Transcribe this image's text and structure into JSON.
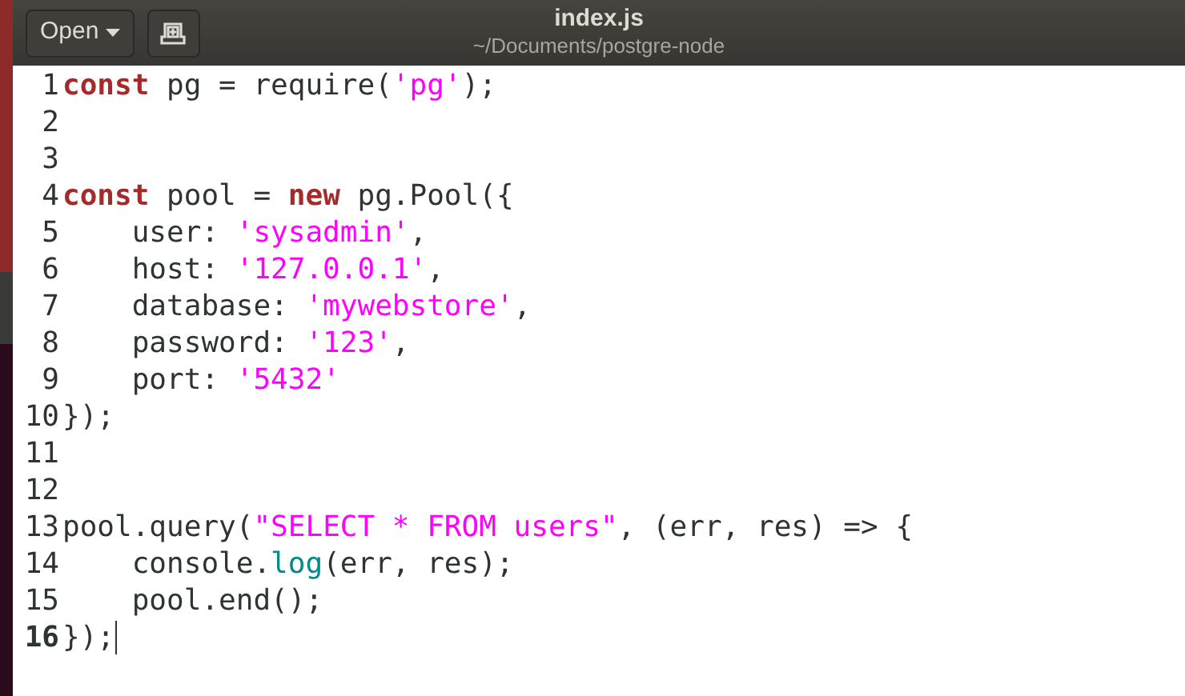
{
  "header": {
    "open_button": {
      "label": "Open"
    },
    "title": "index.js",
    "subtitle": "~/Documents/postgre-node"
  },
  "editor": {
    "lines": [
      {
        "number": "1",
        "current": false,
        "tokens": [
          {
            "kind": "keyword",
            "text": "const"
          },
          {
            "kind": "plain",
            "text": " pg = require("
          },
          {
            "kind": "string",
            "text": "'pg'"
          },
          {
            "kind": "plain",
            "text": ");"
          }
        ]
      },
      {
        "number": "2",
        "current": false
      },
      {
        "number": "3",
        "current": false
      },
      {
        "number": "4",
        "current": false,
        "tokens": [
          {
            "kind": "keyword",
            "text": "const"
          },
          {
            "kind": "plain",
            "text": " pool = "
          },
          {
            "kind": "keyword",
            "text": "new"
          },
          {
            "kind": "plain",
            "text": " pg.Pool({"
          }
        ]
      },
      {
        "number": "5",
        "current": false,
        "tokens": [
          {
            "kind": "plain",
            "text": "    user: "
          },
          {
            "kind": "string",
            "text": "'sysadmin'"
          },
          {
            "kind": "plain",
            "text": ","
          }
        ]
      },
      {
        "number": "6",
        "current": false,
        "tokens": [
          {
            "kind": "plain",
            "text": "    host: "
          },
          {
            "kind": "string",
            "text": "'127.0.0.1'"
          },
          {
            "kind": "plain",
            "text": ","
          }
        ]
      },
      {
        "number": "7",
        "current": false,
        "tokens": [
          {
            "kind": "plain",
            "text": "    database: "
          },
          {
            "kind": "string",
            "text": "'mywebstore'"
          },
          {
            "kind": "plain",
            "text": ","
          }
        ]
      },
      {
        "number": "8",
        "current": false,
        "tokens": [
          {
            "kind": "plain",
            "text": "    password: "
          },
          {
            "kind": "string",
            "text": "'123'"
          },
          {
            "kind": "plain",
            "text": ","
          }
        ]
      },
      {
        "number": "9",
        "current": false,
        "tokens": [
          {
            "kind": "plain",
            "text": "    port: "
          },
          {
            "kind": "string",
            "text": "'5432'"
          }
        ]
      },
      {
        "number": "10",
        "current": false,
        "tokens": [
          {
            "kind": "plain",
            "text": "});"
          }
        ]
      },
      {
        "number": "11",
        "current": false
      },
      {
        "number": "12",
        "current": false
      },
      {
        "number": "13",
        "current": false,
        "tokens": [
          {
            "kind": "plain",
            "text": "pool.query("
          },
          {
            "kind": "string",
            "text": "\"SELECT * FROM users\""
          },
          {
            "kind": "plain",
            "text": ", (err, res) => {"
          }
        ]
      },
      {
        "number": "14",
        "current": false,
        "tokens": [
          {
            "kind": "plain",
            "text": "    console."
          },
          {
            "kind": "builtin",
            "text": "log"
          },
          {
            "kind": "plain",
            "text": "(err, res);"
          }
        ]
      },
      {
        "number": "15",
        "current": false,
        "tokens": [
          {
            "kind": "plain",
            "text": "    pool.end();"
          }
        ]
      },
      {
        "number": "16",
        "current": true,
        "tokens": [
          {
            "kind": "plain",
            "text": "});"
          }
        ]
      }
    ]
  }
}
